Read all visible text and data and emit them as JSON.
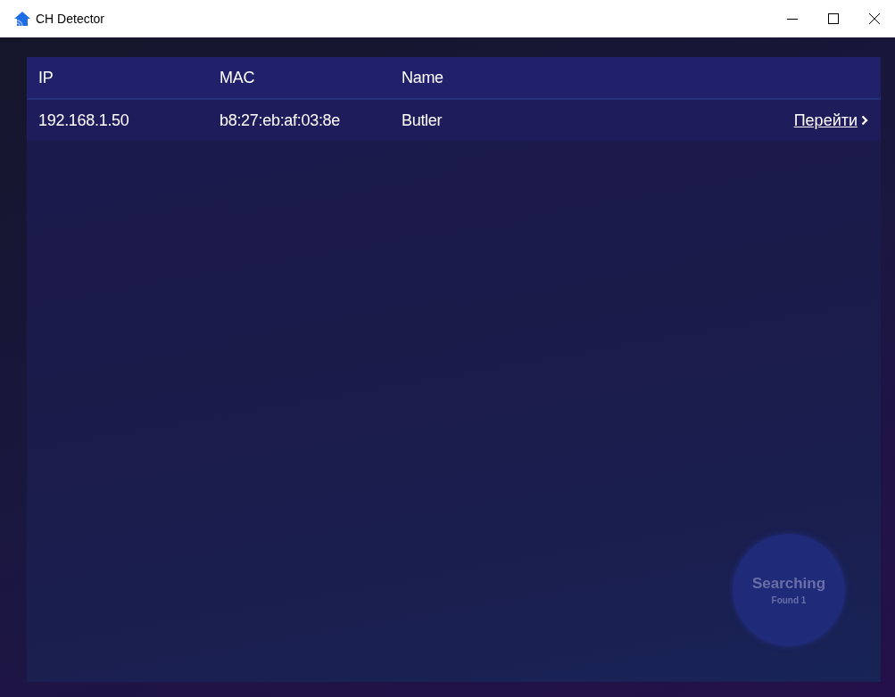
{
  "window": {
    "title": "CH Detector"
  },
  "table": {
    "columns": [
      "IP",
      "MAC",
      "Name"
    ],
    "rows": [
      {
        "ip": "192.168.1.50",
        "mac": "b8:27:eb:af:03:8e",
        "name": "Butler",
        "action": "Перейти"
      }
    ]
  },
  "status": {
    "title": "Searching",
    "subtitle": "Found 1"
  }
}
